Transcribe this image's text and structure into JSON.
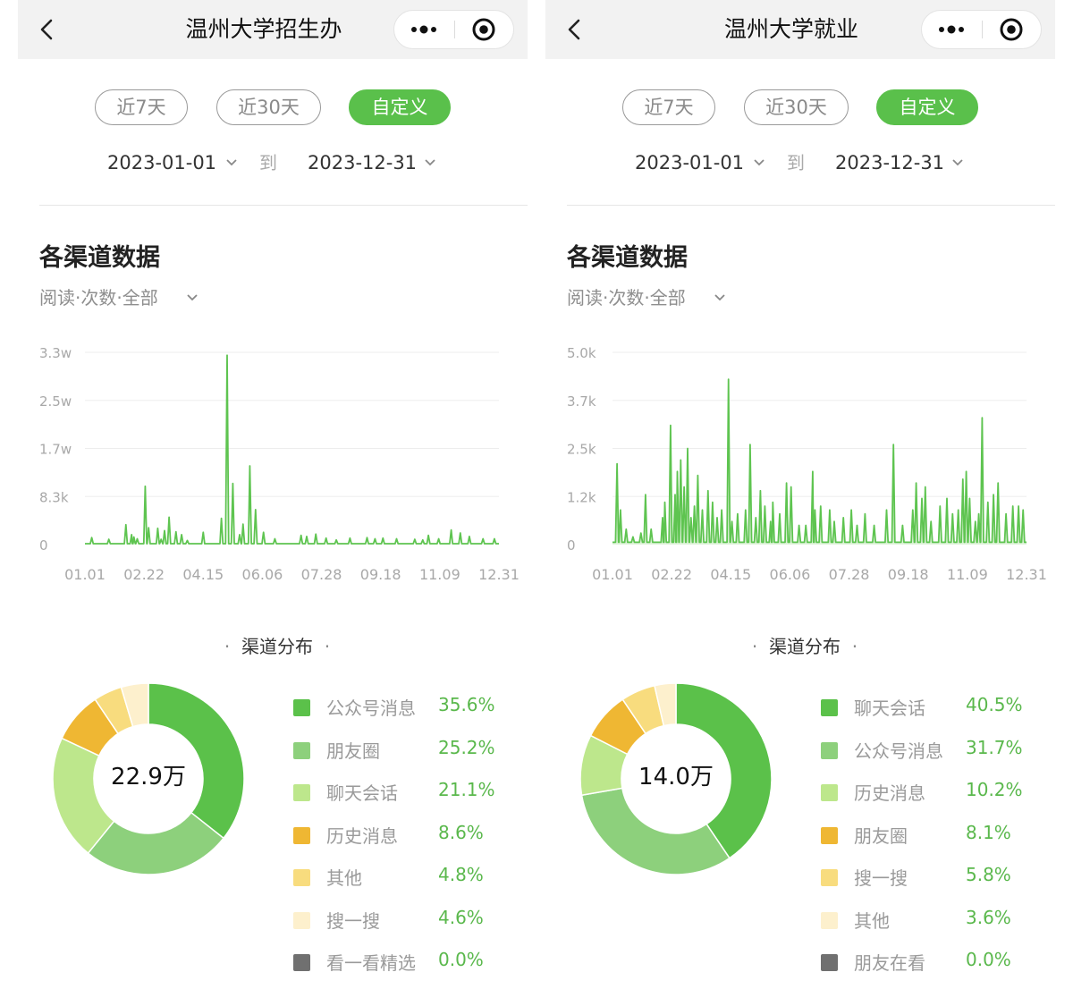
{
  "panels": [
    {
      "title": "温州大学招生办",
      "tabs": [
        "近7天",
        "近30天",
        "自定义"
      ],
      "active_tab": 2,
      "date_from": "2023-01-01",
      "date_sep": "到",
      "date_to": "2023-12-31",
      "section_title": "各渠道数据",
      "filter_label": "阅读·次数·全部",
      "distribution_title": "渠道分布",
      "total": "22.9万",
      "legend": [
        {
          "name": "公众号消息",
          "pct": "35.6%",
          "color": "#5bc14a",
          "value": 35.6
        },
        {
          "name": "朋友圈",
          "pct": "25.2%",
          "color": "#8dd07c",
          "value": 25.2
        },
        {
          "name": "聊天会话",
          "pct": "21.1%",
          "color": "#bde78c",
          "value": 21.1
        },
        {
          "name": "历史消息",
          "pct": "8.6%",
          "color": "#efb733",
          "value": 8.6
        },
        {
          "name": "其他",
          "pct": "4.8%",
          "color": "#f8dc7e",
          "value": 4.8
        },
        {
          "name": "搜一搜",
          "pct": "4.6%",
          "color": "#fdf0cd",
          "value": 4.6
        },
        {
          "name": "看一看精选",
          "pct": "0.0%",
          "color": "#707070",
          "value": 0.0
        }
      ],
      "chart_data": {
        "type": "line",
        "title": "",
        "xlabel": "",
        "ylabel": "",
        "y_tick_labels": [
          "0",
          "8.3k",
          "1.7w",
          "2.5w",
          "3.3w"
        ],
        "x_tick_labels": [
          "01.01",
          "02.22",
          "04.15",
          "06.06",
          "07.28",
          "09.18",
          "11.09",
          "12.31"
        ],
        "x_range_days": [
          0,
          364
        ],
        "ylim": [
          0,
          33000
        ],
        "grid": true,
        "fill_area": false,
        "baseline": 150,
        "peaks": [
          [
            6,
            1200
          ],
          [
            21,
            900
          ],
          [
            36,
            3400
          ],
          [
            41,
            1700
          ],
          [
            43,
            1300
          ],
          [
            46,
            1000
          ],
          [
            53,
            10000
          ],
          [
            56,
            2900
          ],
          [
            64,
            2800
          ],
          [
            67,
            900
          ],
          [
            70,
            2400
          ],
          [
            74,
            4700
          ],
          [
            80,
            2200
          ],
          [
            85,
            1700
          ],
          [
            90,
            700
          ],
          [
            104,
            2100
          ],
          [
            120,
            4500
          ],
          [
            125,
            32500
          ],
          [
            130,
            10500
          ],
          [
            136,
            1700
          ],
          [
            139,
            3500
          ],
          [
            145,
            13500
          ],
          [
            150,
            6000
          ],
          [
            157,
            2100
          ],
          [
            167,
            1000
          ],
          [
            190,
            1600
          ],
          [
            195,
            1400
          ],
          [
            203,
            1800
          ],
          [
            212,
            1100
          ],
          [
            221,
            800
          ],
          [
            233,
            1100
          ],
          [
            248,
            1200
          ],
          [
            255,
            1000
          ],
          [
            262,
            1100
          ],
          [
            274,
            1000
          ],
          [
            290,
            900
          ],
          [
            297,
            800
          ],
          [
            302,
            1600
          ],
          [
            311,
            1000
          ],
          [
            322,
            2500
          ],
          [
            330,
            2000
          ],
          [
            338,
            1400
          ],
          [
            350,
            1000
          ],
          [
            360,
            1000
          ]
        ]
      }
    },
    {
      "title": "温州大学就业",
      "tabs": [
        "近7天",
        "近30天",
        "自定义"
      ],
      "active_tab": 2,
      "date_from": "2023-01-01",
      "date_sep": "到",
      "date_to": "2023-12-31",
      "section_title": "各渠道数据",
      "filter_label": "阅读·次数·全部",
      "distribution_title": "渠道分布",
      "total": "14.0万",
      "legend": [
        {
          "name": "聊天会话",
          "pct": "40.5%",
          "color": "#5bc14a",
          "value": 40.5
        },
        {
          "name": "公众号消息",
          "pct": "31.7%",
          "color": "#8dd07c",
          "value": 31.7
        },
        {
          "name": "历史消息",
          "pct": "10.2%",
          "color": "#bde78c",
          "value": 10.2
        },
        {
          "name": "朋友圈",
          "pct": "8.1%",
          "color": "#efb733",
          "value": 8.1
        },
        {
          "name": "搜一搜",
          "pct": "5.8%",
          "color": "#f8dc7e",
          "value": 5.8
        },
        {
          "name": "其他",
          "pct": "3.6%",
          "color": "#fdf0cd",
          "value": 3.6
        },
        {
          "name": "朋友在看",
          "pct": "0.0%",
          "color": "#707070",
          "value": 0.0
        }
      ],
      "chart_data": {
        "type": "area",
        "title": "",
        "xlabel": "",
        "ylabel": "",
        "y_tick_labels": [
          "0",
          "1.2k",
          "2.5k",
          "3.7k",
          "5.0k"
        ],
        "x_tick_labels": [
          "01.01",
          "02.22",
          "04.15",
          "06.06",
          "07.28",
          "09.18",
          "11.09",
          "12.31"
        ],
        "x_range_days": [
          0,
          364
        ],
        "ylim": [
          0,
          5000
        ],
        "grid": true,
        "fill_area": true,
        "baseline": 60,
        "peaks": [
          [
            4,
            2100
          ],
          [
            7,
            900
          ],
          [
            12,
            400
          ],
          [
            18,
            200
          ],
          [
            25,
            300
          ],
          [
            29,
            1300
          ],
          [
            34,
            400
          ],
          [
            44,
            700
          ],
          [
            46,
            1100
          ],
          [
            51,
            3100
          ],
          [
            55,
            1300
          ],
          [
            57,
            1900
          ],
          [
            60,
            2200
          ],
          [
            63,
            1500
          ],
          [
            66,
            2500
          ],
          [
            69,
            700
          ],
          [
            72,
            1000
          ],
          [
            75,
            1800
          ],
          [
            79,
            900
          ],
          [
            84,
            1400
          ],
          [
            88,
            1100
          ],
          [
            92,
            700
          ],
          [
            96,
            900
          ],
          [
            102,
            4300
          ],
          [
            105,
            600
          ],
          [
            110,
            800
          ],
          [
            117,
            900
          ],
          [
            121,
            2600
          ],
          [
            126,
            700
          ],
          [
            130,
            1400
          ],
          [
            134,
            1000
          ],
          [
            139,
            600
          ],
          [
            141,
            1100
          ],
          [
            147,
            800
          ],
          [
            153,
            1600
          ],
          [
            157,
            1500
          ],
          [
            164,
            500
          ],
          [
            170,
            500
          ],
          [
            176,
            1900
          ],
          [
            178,
            900
          ],
          [
            183,
            1000
          ],
          [
            191,
            900
          ],
          [
            195,
            600
          ],
          [
            203,
            700
          ],
          [
            210,
            900
          ],
          [
            215,
            500
          ],
          [
            222,
            800
          ],
          [
            230,
            500
          ],
          [
            241,
            900
          ],
          [
            247,
            2600
          ],
          [
            255,
            500
          ],
          [
            264,
            900
          ],
          [
            267,
            1600
          ],
          [
            272,
            1200
          ],
          [
            275,
            1500
          ],
          [
            280,
            600
          ],
          [
            288,
            1000
          ],
          [
            294,
            1200
          ],
          [
            299,
            800
          ],
          [
            304,
            900
          ],
          [
            308,
            1700
          ],
          [
            311,
            1900
          ],
          [
            314,
            1200
          ],
          [
            319,
            600
          ],
          [
            322,
            800
          ],
          [
            325,
            3300
          ],
          [
            330,
            1100
          ],
          [
            335,
            1300
          ],
          [
            339,
            1600
          ],
          [
            346,
            800
          ],
          [
            352,
            1000
          ],
          [
            357,
            1000
          ],
          [
            361,
            900
          ]
        ]
      }
    }
  ]
}
